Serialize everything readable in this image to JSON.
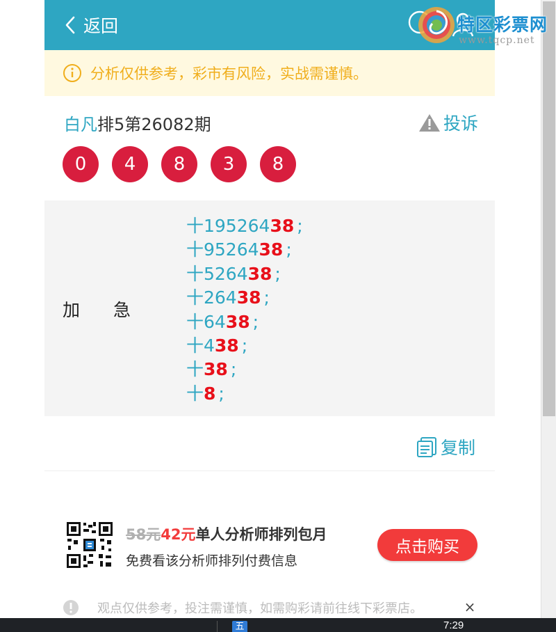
{
  "header": {
    "back_label": "返回"
  },
  "watermark": {
    "name": "特区彩票网",
    "url": "www.tqcp.net"
  },
  "notice": {
    "icon": "info-circle-icon",
    "text": "分析仅供参考，彩市有风险，实战需谨慎。"
  },
  "issue": {
    "analyst": "白凡",
    "title": "排5第26082期",
    "complain_label": "投诉"
  },
  "balls": [
    "0",
    "4",
    "8",
    "3",
    "8"
  ],
  "colors": {
    "primary": "#2ea6c2",
    "ball": "#d81e3e",
    "highlight": "#e8101a",
    "notice_text": "#f0ae1c",
    "buy_button": "#f23b3b"
  },
  "prediction": {
    "label": "加急",
    "lines": [
      {
        "prefix": "十195264",
        "highlight": "38",
        "sep": ";"
      },
      {
        "prefix": "十95264",
        "highlight": "38",
        "sep": ";"
      },
      {
        "prefix": "十5264",
        "highlight": "38",
        "sep": ";"
      },
      {
        "prefix": "十264",
        "highlight": "38",
        "sep": ";"
      },
      {
        "prefix": "十64",
        "highlight": "38",
        "sep": ";"
      },
      {
        "prefix": "十4",
        "highlight": "38",
        "sep": ";"
      },
      {
        "prefix": "十",
        "highlight": "38",
        "sep": ";"
      },
      {
        "prefix": "十",
        "highlight": "8",
        "sep": ";"
      }
    ]
  },
  "copy_label": "复制",
  "promo": {
    "old_price": "58元",
    "new_price": "42元",
    "title": "单人分析师排列包月",
    "subtitle": "免费看该分析师排列付费信息",
    "buy_label": "点击购买"
  },
  "disclaimer": {
    "text": "观点仅供参考，投注需谨慎，如需购彩请前往线下彩票店。",
    "close": "×"
  },
  "taskbar": {
    "ime": "五",
    "time": "7:29"
  }
}
